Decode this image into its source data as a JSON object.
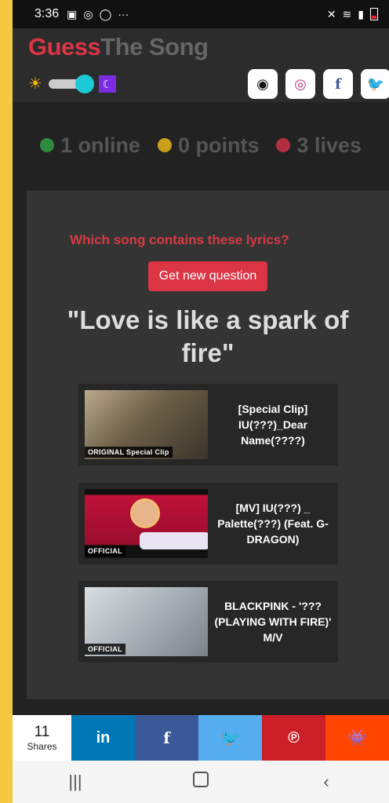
{
  "status_bar": {
    "time": "3:36",
    "dots": "···"
  },
  "header": {
    "logo_part1": "Guess",
    "logo_part2": "The Song",
    "theme_sun": "☀",
    "theme_moon": "☾",
    "social": [
      {
        "name": "github-icon",
        "glyph": "◉"
      },
      {
        "name": "instagram-icon",
        "glyph": "◎"
      },
      {
        "name": "facebook-icon",
        "glyph": "f"
      },
      {
        "name": "twitter-icon",
        "glyph": "🐦"
      }
    ]
  },
  "stats": {
    "online": "1 online",
    "points": "0 points",
    "lives": "3 lives",
    "colors": {
      "online": "#2e8b3e",
      "points": "#c9a018",
      "lives": "#b03040"
    }
  },
  "quiz": {
    "prompt": "Which song contains these lyrics?",
    "button": "Get new question",
    "lyrics": "\"Love is like a spark of fire\"",
    "options": [
      {
        "title": "[Special Clip] IU(???)_Dear Name(????)",
        "tag": "ORIGINAL Special Clip"
      },
      {
        "title": "[MV] IU(???) _ Palette(???) (Feat. G-DRAGON)",
        "tag": "OFFICIAL"
      },
      {
        "title": "BLACKPINK - '??? (PLAYING WITH FIRE)' M/V",
        "tag": "OFFICIAL"
      }
    ]
  },
  "share_bar": {
    "count": "11",
    "count_label": "Shares",
    "linkedin": "in",
    "facebook": "f",
    "twitter": "🐦",
    "pinterest": "℗",
    "reddit": "👾"
  },
  "nav": {
    "recent": "|||",
    "back": "‹"
  }
}
